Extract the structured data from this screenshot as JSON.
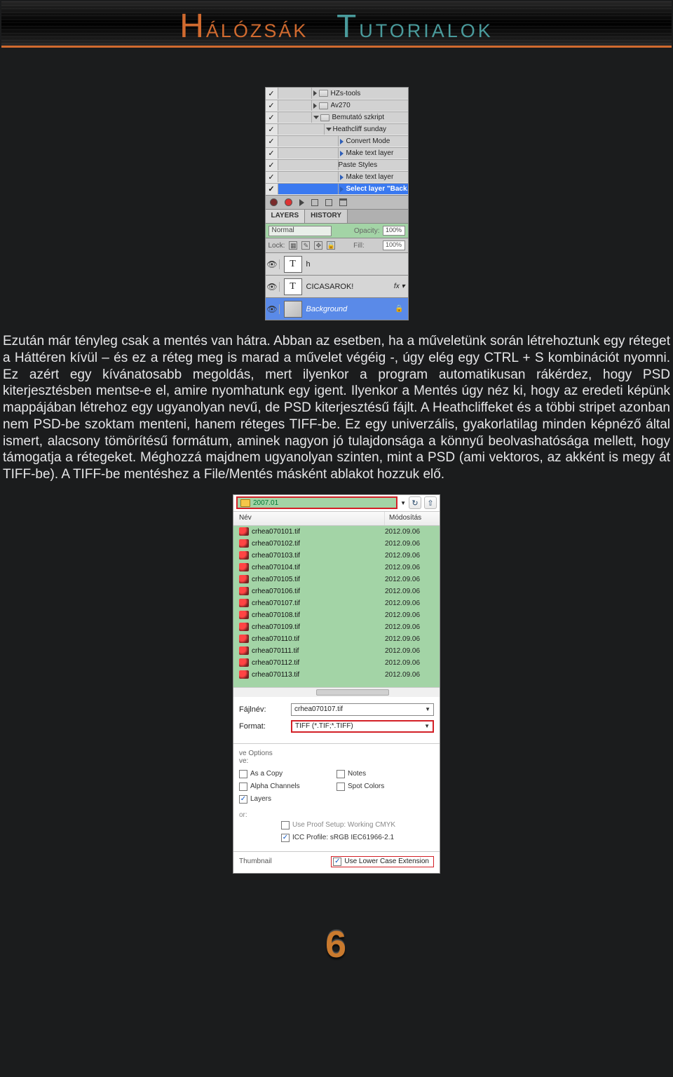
{
  "header": {
    "word1": "Hálózsák",
    "word2": "Tutorialok"
  },
  "ps_panel": {
    "rows": [
      {
        "label": "HZs-tools",
        "indent": 1,
        "chk": true,
        "tri": "right",
        "folder": true
      },
      {
        "label": "Av270",
        "indent": 1,
        "chk": true,
        "tri": "right",
        "folder": true
      },
      {
        "label": "Bemutató szkript",
        "indent": 1,
        "chk": true,
        "tri": "down",
        "folder": true
      },
      {
        "label": "Heathcliff sunday",
        "indent": 2,
        "chk": true,
        "tri": "down",
        "folder": false
      },
      {
        "label": "Convert Mode",
        "indent": 3,
        "chk": true,
        "play": true
      },
      {
        "label": "Make text layer",
        "indent": 3,
        "chk": true,
        "play": true
      },
      {
        "label": "Paste Styles",
        "indent": 3,
        "chk": true,
        "play": false
      },
      {
        "label": "Make text layer",
        "indent": 3,
        "chk": true,
        "play": true
      },
      {
        "label": "Select layer \"Back…",
        "indent": 3,
        "chk": true,
        "play": true,
        "sel": true
      }
    ],
    "tabs": {
      "layers": "LAYERS",
      "history": "HISTORY"
    },
    "blend_mode": "Normal",
    "opacity_label": "Opacity:",
    "opacity_value": "100%",
    "lock_label": "Lock:",
    "fill_label": "Fill:",
    "fill_value": "100%",
    "layers": [
      {
        "name": "h",
        "thumb": "T",
        "fx": false,
        "bg": false
      },
      {
        "name": "CICASAROK!",
        "thumb": "T",
        "fx": true,
        "bg": false
      },
      {
        "name": "Background",
        "thumb": "",
        "fx": false,
        "bg": true,
        "lock": true
      }
    ]
  },
  "body_text": "Ezután már tényleg csak a mentés van hátra. Abban az esetben, ha a műveletünk során létrehoztunk egy réteget a Háttéren kívül – és ez a réteg meg is marad a művelet végéig -, úgy elég egy CTRL + S kombinációt nyomni. Ez azért egy kívánatosabb megoldás, mert ilyenkor a program automatikusan rákérdez, hogy PSD kiterjesztésben mentse-e el, amire nyomhatunk egy igent. Ilyenkor a Mentés úgy néz ki, hogy az eredeti képünk mappájában létrehoz egy ugyanolyan nevű, de PSD kiterjesztésű fájlt. A Heathcliffeket és a többi stripet azonban nem PSD-be szoktam menteni, hanem réteges TIFF-be. Ez egy univerzális, gyakorlatilag minden képnéző által ismert, alacsony tömörítésű formátum, aminek nagyon jó tulajdonsága a könnyű beolvashatósága mellett, hogy támogatja a rétegeket. Méghozzá majdnem ugyanolyan szinten, mint a PSD (ami vektoros, az akként is megy át TIFF-be). A TIFF-be mentéshez a File/Mentés másként ablakot hozzuk elő.",
  "dialog": {
    "path": "2007.01",
    "headers": {
      "name": "Név",
      "modified": "Módosítás"
    },
    "files": [
      {
        "name": "crhea070101.tif",
        "date": "2012.09.06"
      },
      {
        "name": "crhea070102.tif",
        "date": "2012.09.06"
      },
      {
        "name": "crhea070103.tif",
        "date": "2012.09.06"
      },
      {
        "name": "crhea070104.tif",
        "date": "2012.09.06"
      },
      {
        "name": "crhea070105.tif",
        "date": "2012.09.06"
      },
      {
        "name": "crhea070106.tif",
        "date": "2012.09.06"
      },
      {
        "name": "crhea070107.tif",
        "date": "2012.09.06"
      },
      {
        "name": "crhea070108.tif",
        "date": "2012.09.06"
      },
      {
        "name": "crhea070109.tif",
        "date": "2012.09.06"
      },
      {
        "name": "crhea070110.tif",
        "date": "2012.09.06"
      },
      {
        "name": "crhea070111.tif",
        "date": "2012.09.06"
      },
      {
        "name": "crhea070112.tif",
        "date": "2012.09.06"
      },
      {
        "name": "crhea070113.tif",
        "date": "2012.09.06"
      }
    ],
    "filename_label": "Fájlnév:",
    "filename_value": "crhea070107.tif",
    "format_label": "Format:",
    "format_value": "TIFF (*.TIF;*.TIFF)",
    "save_options_label": "ve Options",
    "save_sub_label": "ve:",
    "cb_as_copy": "As a Copy",
    "cb_notes": "Notes",
    "cb_alpha": "Alpha Channels",
    "cb_spot": "Spot Colors",
    "cb_layers": "Layers",
    "color_label": "or:",
    "cb_proof": "Use Proof Setup:  Working CMYK",
    "cb_icc": "ICC Profile:  sRGB IEC61966-2.1",
    "thumbnail_label": "Thumbnail",
    "cb_lowercase": "Use Lower Case Extension"
  },
  "page_number": "6"
}
